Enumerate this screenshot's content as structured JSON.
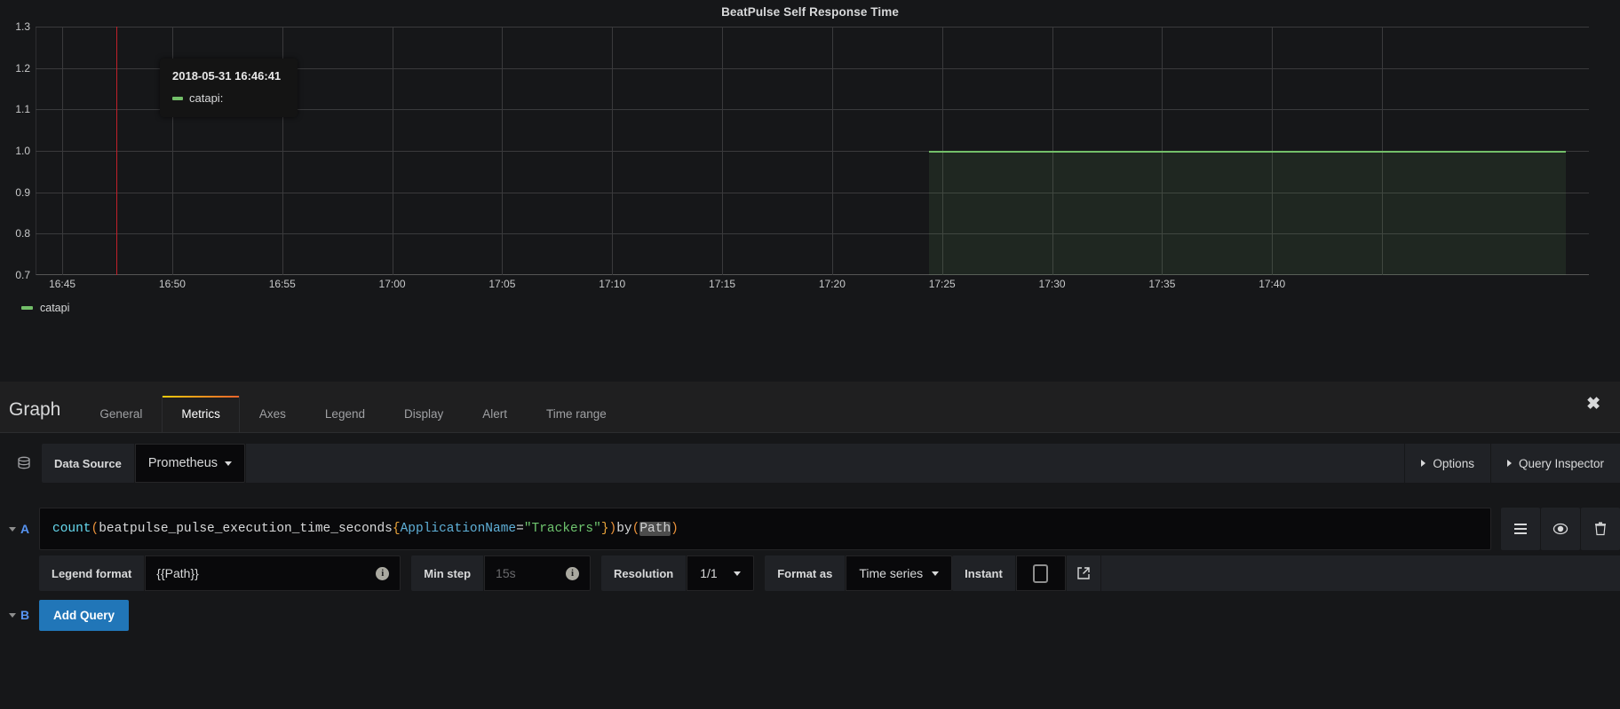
{
  "panel": {
    "title": "BeatPulse Self Response Time",
    "legend": [
      {
        "label": "catapi",
        "color": "#73bf69"
      }
    ],
    "tooltip": {
      "time": "2018-05-31 16:46:41",
      "series_label": "catapi:",
      "color": "#73bf69"
    }
  },
  "chart_data": {
    "type": "area",
    "title": "BeatPulse Self Response Time",
    "xlabel": "",
    "ylabel": "",
    "ylim": [
      0.7,
      1.3
    ],
    "yticks": [
      "0.7",
      "0.8",
      "0.9",
      "1.0",
      "1.1",
      "1.2",
      "1.3"
    ],
    "xticks": [
      "16:45",
      "16:50",
      "16:55",
      "17:00",
      "17:05",
      "17:10",
      "17:15",
      "17:20",
      "17:25",
      "17:30",
      "17:35",
      "17:40"
    ],
    "grid": true,
    "legend_position": "bottom-left",
    "series": [
      {
        "name": "catapi",
        "color": "#73bf69",
        "x": [
          "17:24",
          "17:26",
          "17:28",
          "17:30",
          "17:32",
          "17:34",
          "17:36",
          "17:38",
          "17:40",
          "17:42"
        ],
        "values": [
          1.0,
          1.0,
          1.0,
          1.0,
          1.0,
          1.0,
          1.0,
          1.0,
          1.0,
          1.0
        ]
      }
    ],
    "annotations": [
      {
        "type": "crosshair",
        "x": "16:46:41",
        "color": "#c0202a"
      }
    ]
  },
  "editor": {
    "title": "Graph",
    "tabs": [
      {
        "label": "General",
        "active": false
      },
      {
        "label": "Metrics",
        "active": true
      },
      {
        "label": "Axes",
        "active": false
      },
      {
        "label": "Legend",
        "active": false
      },
      {
        "label": "Display",
        "active": false
      },
      {
        "label": "Alert",
        "active": false
      },
      {
        "label": "Time range",
        "active": false
      }
    ],
    "close_label": "✖",
    "accent_color": "#e8622c"
  },
  "datasource": {
    "icon": "database-icon",
    "label": "Data Source",
    "value": "Prometheus",
    "options_label": "Options",
    "query_inspector_label": "Query Inspector"
  },
  "queries": [
    {
      "ref_id": "A",
      "expression": {
        "full": "count(beatpulse_pulse_execution_time_seconds{ApplicationName=\"Trackers\"}) by (Path)",
        "tokens": {
          "fn": "count",
          "open_paren": "(",
          "metric": "beatpulse_pulse_execution_time_seconds",
          "open_brace": "{",
          "label_name": "ApplicationName",
          "equals": "=",
          "label_value": "\"Trackers\"",
          "close_brace": "}",
          "close_paren": ")",
          "keyword": " by ",
          "group_open": "(",
          "group_by": "Path",
          "group_close": ")"
        }
      },
      "actions": [
        {
          "name": "query-menu",
          "icon": "hamburger-icon"
        },
        {
          "name": "toggle-visibility",
          "icon": "eye-icon"
        },
        {
          "name": "remove-query",
          "icon": "trash-icon"
        }
      ],
      "options": {
        "legend_format_label": "Legend format",
        "legend_format_value": "{{Path}}",
        "min_step_label": "Min step",
        "min_step_placeholder": "15s",
        "min_step_value": "",
        "resolution_label": "Resolution",
        "resolution_value": "1/1",
        "format_as_label": "Format as",
        "format_as_value": "Time series",
        "instant_label": "Instant",
        "instant_checked": false,
        "external_link_icon": "share-icon"
      }
    },
    {
      "ref_id": "B",
      "add_query_label": "Add Query"
    }
  ]
}
